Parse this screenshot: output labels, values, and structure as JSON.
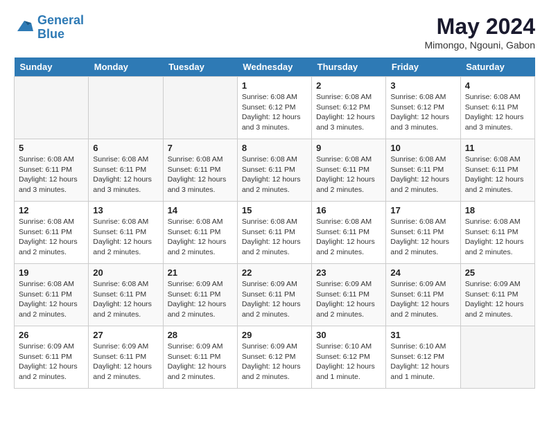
{
  "logo": {
    "line1": "General",
    "line2": "Blue"
  },
  "title": "May 2024",
  "location": "Mimongo, Ngouni, Gabon",
  "days_of_week": [
    "Sunday",
    "Monday",
    "Tuesday",
    "Wednesday",
    "Thursday",
    "Friday",
    "Saturday"
  ],
  "weeks": [
    [
      {
        "day": "",
        "info": ""
      },
      {
        "day": "",
        "info": ""
      },
      {
        "day": "",
        "info": ""
      },
      {
        "day": "1",
        "info": "Sunrise: 6:08 AM\nSunset: 6:12 PM\nDaylight: 12 hours\nand 3 minutes."
      },
      {
        "day": "2",
        "info": "Sunrise: 6:08 AM\nSunset: 6:12 PM\nDaylight: 12 hours\nand 3 minutes."
      },
      {
        "day": "3",
        "info": "Sunrise: 6:08 AM\nSunset: 6:12 PM\nDaylight: 12 hours\nand 3 minutes."
      },
      {
        "day": "4",
        "info": "Sunrise: 6:08 AM\nSunset: 6:11 PM\nDaylight: 12 hours\nand 3 minutes."
      }
    ],
    [
      {
        "day": "5",
        "info": "Sunrise: 6:08 AM\nSunset: 6:11 PM\nDaylight: 12 hours\nand 3 minutes."
      },
      {
        "day": "6",
        "info": "Sunrise: 6:08 AM\nSunset: 6:11 PM\nDaylight: 12 hours\nand 3 minutes."
      },
      {
        "day": "7",
        "info": "Sunrise: 6:08 AM\nSunset: 6:11 PM\nDaylight: 12 hours\nand 3 minutes."
      },
      {
        "day": "8",
        "info": "Sunrise: 6:08 AM\nSunset: 6:11 PM\nDaylight: 12 hours\nand 2 minutes."
      },
      {
        "day": "9",
        "info": "Sunrise: 6:08 AM\nSunset: 6:11 PM\nDaylight: 12 hours\nand 2 minutes."
      },
      {
        "day": "10",
        "info": "Sunrise: 6:08 AM\nSunset: 6:11 PM\nDaylight: 12 hours\nand 2 minutes."
      },
      {
        "day": "11",
        "info": "Sunrise: 6:08 AM\nSunset: 6:11 PM\nDaylight: 12 hours\nand 2 minutes."
      }
    ],
    [
      {
        "day": "12",
        "info": "Sunrise: 6:08 AM\nSunset: 6:11 PM\nDaylight: 12 hours\nand 2 minutes."
      },
      {
        "day": "13",
        "info": "Sunrise: 6:08 AM\nSunset: 6:11 PM\nDaylight: 12 hours\nand 2 minutes."
      },
      {
        "day": "14",
        "info": "Sunrise: 6:08 AM\nSunset: 6:11 PM\nDaylight: 12 hours\nand 2 minutes."
      },
      {
        "day": "15",
        "info": "Sunrise: 6:08 AM\nSunset: 6:11 PM\nDaylight: 12 hours\nand 2 minutes."
      },
      {
        "day": "16",
        "info": "Sunrise: 6:08 AM\nSunset: 6:11 PM\nDaylight: 12 hours\nand 2 minutes."
      },
      {
        "day": "17",
        "info": "Sunrise: 6:08 AM\nSunset: 6:11 PM\nDaylight: 12 hours\nand 2 minutes."
      },
      {
        "day": "18",
        "info": "Sunrise: 6:08 AM\nSunset: 6:11 PM\nDaylight: 12 hours\nand 2 minutes."
      }
    ],
    [
      {
        "day": "19",
        "info": "Sunrise: 6:08 AM\nSunset: 6:11 PM\nDaylight: 12 hours\nand 2 minutes."
      },
      {
        "day": "20",
        "info": "Sunrise: 6:08 AM\nSunset: 6:11 PM\nDaylight: 12 hours\nand 2 minutes."
      },
      {
        "day": "21",
        "info": "Sunrise: 6:09 AM\nSunset: 6:11 PM\nDaylight: 12 hours\nand 2 minutes."
      },
      {
        "day": "22",
        "info": "Sunrise: 6:09 AM\nSunset: 6:11 PM\nDaylight: 12 hours\nand 2 minutes."
      },
      {
        "day": "23",
        "info": "Sunrise: 6:09 AM\nSunset: 6:11 PM\nDaylight: 12 hours\nand 2 minutes."
      },
      {
        "day": "24",
        "info": "Sunrise: 6:09 AM\nSunset: 6:11 PM\nDaylight: 12 hours\nand 2 minutes."
      },
      {
        "day": "25",
        "info": "Sunrise: 6:09 AM\nSunset: 6:11 PM\nDaylight: 12 hours\nand 2 minutes."
      }
    ],
    [
      {
        "day": "26",
        "info": "Sunrise: 6:09 AM\nSunset: 6:11 PM\nDaylight: 12 hours\nand 2 minutes."
      },
      {
        "day": "27",
        "info": "Sunrise: 6:09 AM\nSunset: 6:11 PM\nDaylight: 12 hours\nand 2 minutes."
      },
      {
        "day": "28",
        "info": "Sunrise: 6:09 AM\nSunset: 6:11 PM\nDaylight: 12 hours\nand 2 minutes."
      },
      {
        "day": "29",
        "info": "Sunrise: 6:09 AM\nSunset: 6:12 PM\nDaylight: 12 hours\nand 2 minutes."
      },
      {
        "day": "30",
        "info": "Sunrise: 6:10 AM\nSunset: 6:12 PM\nDaylight: 12 hours\nand 1 minute."
      },
      {
        "day": "31",
        "info": "Sunrise: 6:10 AM\nSunset: 6:12 PM\nDaylight: 12 hours\nand 1 minute."
      },
      {
        "day": "",
        "info": ""
      }
    ]
  ]
}
